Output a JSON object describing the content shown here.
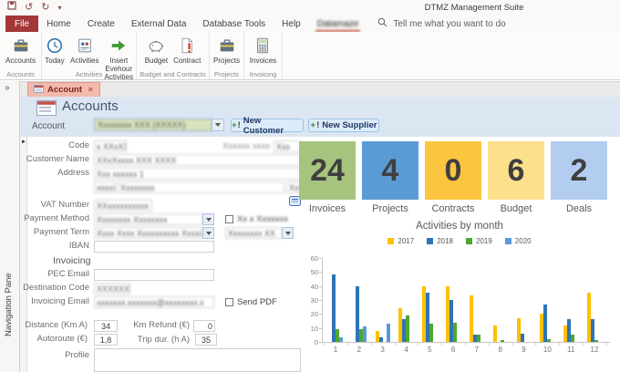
{
  "window": {
    "title": "DTMZ Management Suite"
  },
  "glyphs": {
    "undo": "↺",
    "redo": "↻",
    "caret": "▾",
    "nav_expand": "»",
    "record_arrow": "►",
    "close": "✕"
  },
  "ribbon": {
    "search_placeholder": "Tell me what you want to do",
    "tabs": [
      {
        "label": "File",
        "file": true
      },
      {
        "label": "Home"
      },
      {
        "label": "Create"
      },
      {
        "label": "External Data"
      },
      {
        "label": "Database Tools"
      },
      {
        "label": "Help"
      },
      {
        "label": "Datamaze",
        "active": true,
        "redacted": true
      }
    ],
    "groups": [
      {
        "label": "Accounts",
        "buttons": [
          {
            "label": "Accounts"
          }
        ]
      },
      {
        "label": "Activities",
        "buttons": [
          {
            "label": "Today"
          },
          {
            "label": "Activities"
          },
          {
            "label": "Insert Evehour Activities"
          }
        ]
      },
      {
        "label": "Budget and Contracts",
        "buttons": [
          {
            "label": "Budget"
          },
          {
            "label": "Contract"
          }
        ]
      },
      {
        "label": "Projects",
        "buttons": [
          {
            "label": "Projects"
          }
        ]
      },
      {
        "label": "Invoicing",
        "buttons": [
          {
            "label": "Invoices"
          }
        ]
      }
    ]
  },
  "nav_pane": {
    "label": "Navigation Pane"
  },
  "doc_tab": {
    "label": "Account"
  },
  "form": {
    "title": "Accounts",
    "account_label": "Account",
    "account_value_redacted": "Xxxxxxxx XXX (XXXXX)",
    "new_customer": "New Customer",
    "new_supplier": "New Supplier",
    "btn_plus": "+",
    "btn_excl": "!",
    "fields": {
      "code": {
        "label": "Code",
        "value_redacted": "x XXxXX"
      },
      "top_right": {
        "label_redacted": "Xxxxxx xxxx",
        "value_redacted": "Xxx"
      },
      "customer_name": {
        "label": "Customer Name",
        "value_redacted": "XXxXxxxx XXX XXXX"
      },
      "address": {
        "label": "Address",
        "value_redacted": "Xxx xxxxxx 1"
      },
      "address2": {
        "a_redacted": "xxxxx",
        "b_redacted": "Xxxxxxxx",
        "c_redacted": "Xxx"
      },
      "vat": {
        "label": "VAT Number",
        "value_redacted": "XXxxxxxxxxxx"
      },
      "payment_method": {
        "label": "Payment Method",
        "value_redacted": "Xxxxxxxx Xxxxxxxx",
        "side_label_redacted": "Xx x Xxxxxxx"
      },
      "payment_term": {
        "label": "Payment Term",
        "value_redacted": "Xxxx Xxxx Xxxxxxxxxx Xxxxx (XX)",
        "side_value_redacted": "Xxxxxxxx XX"
      },
      "iban": {
        "label": "IBAN",
        "value": ""
      },
      "invoicing_section": "Invoicing",
      "pec_email": {
        "label": "PEC Email",
        "value": ""
      },
      "destination_code": {
        "label": "Destination Code",
        "value_redacted": "XXXXXXX"
      },
      "invoicing_email": {
        "label": "Invoicing Email",
        "value_redacted": "xxxxxxx.xxxxxxx@xxxxxxxx.x",
        "send_pdf_label": "Send PDF"
      },
      "distance": {
        "label": "Distance (Km A)",
        "value": "34"
      },
      "km_refund": {
        "label": "Km Refund (€)",
        "value": "0"
      },
      "autoroute": {
        "label": "Autoroute (€)",
        "value": "1,8"
      },
      "trip_dur": {
        "label": "Trip dur. (h A)",
        "value": "35"
      },
      "profile": {
        "label": "Profile",
        "value": ""
      }
    }
  },
  "kpis": [
    {
      "value": "24",
      "label": "Invoices",
      "color": "#A6C47E"
    },
    {
      "value": "4",
      "label": "Projects",
      "color": "#5B9BD5"
    },
    {
      "value": "0",
      "label": "Contracts",
      "color": "#FBC540"
    },
    {
      "value": "6",
      "label": "Budget",
      "color": "#FCE08C"
    },
    {
      "value": "2",
      "label": "Deals",
      "color": "#B3CDF0"
    }
  ],
  "chart_data": {
    "type": "bar",
    "title": "Activities by month",
    "categories": [
      "1",
      "2",
      "3",
      "4",
      "5",
      "6",
      "7",
      "8",
      "9",
      "10",
      "11",
      "12"
    ],
    "series": [
      {
        "name": "2017",
        "color": "#FFC000",
        "values": [
          0,
          0,
          8,
          24,
          40,
          40,
          33,
          12,
          17,
          20,
          12,
          35
        ]
      },
      {
        "name": "2018",
        "color": "#2E75B6",
        "values": [
          48,
          40,
          3,
          16,
          35,
          30,
          5,
          0,
          6,
          27,
          16,
          16
        ]
      },
      {
        "name": "2019",
        "color": "#4EA72E",
        "values": [
          9,
          9,
          0,
          19,
          13,
          14,
          5,
          1,
          0,
          2,
          5,
          1
        ]
      },
      {
        "name": "2020",
        "color": "#5B9BD5",
        "values": [
          3,
          11,
          13,
          0,
          0,
          0,
          0,
          0,
          0,
          0,
          0,
          0
        ]
      }
    ],
    "ylim": [
      0,
      60
    ],
    "ytick_step": 10,
    "xlabel": "",
    "ylabel": "",
    "legend_position": "top",
    "grid": false
  }
}
